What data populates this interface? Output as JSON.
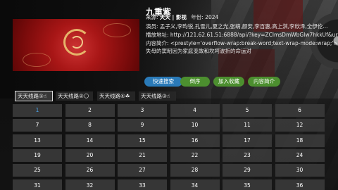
{
  "title": "九重紫",
  "source_label": "来源:",
  "source_value": "天天 | 影视",
  "year_label": "年份:",
  "year_value": "2024",
  "cast_label": "演员:",
  "cast_value": "孟子义,李昀锐,孔雪儿,夏之光,张萌,颜安,李百惠,高上淇,李欣泽,全伊伦...",
  "url_label": "播放地址:",
  "url_value": "http://121.62.61.51:6888/api/?key=ZClmsDmWbGlw7hkkUf&url=...",
  "desc_label": "内容简介:",
  "desc_line1": "<prestyle='overflow-wrap:break-word;text-wrap-mode:wrap;'>年少",
  "desc_line2": "失母的窦昭因为家庭变故和坎坷波折的命运对",
  "buttons": {
    "search": "快速搜索",
    "order": "倒序",
    "favorite": "加入收藏",
    "intro": "内容简介"
  },
  "lines": [
    {
      "label": "天天线路①☝"
    },
    {
      "label": "天天线路②🌕"
    },
    {
      "label": "天天线路④☘"
    },
    {
      "label": "天天线路③☝"
    }
  ],
  "active_episode": "1",
  "episodes": [
    "1",
    "2",
    "3",
    "4",
    "5",
    "6",
    "7",
    "8",
    "9",
    "10",
    "11",
    "12",
    "13",
    "14",
    "15",
    "16",
    "17",
    "18",
    "19",
    "20",
    "21",
    "22",
    "23",
    "24",
    "25",
    "26",
    "27",
    "28",
    "29",
    "30",
    "31",
    "32",
    "33",
    "34",
    "35",
    "36"
  ]
}
